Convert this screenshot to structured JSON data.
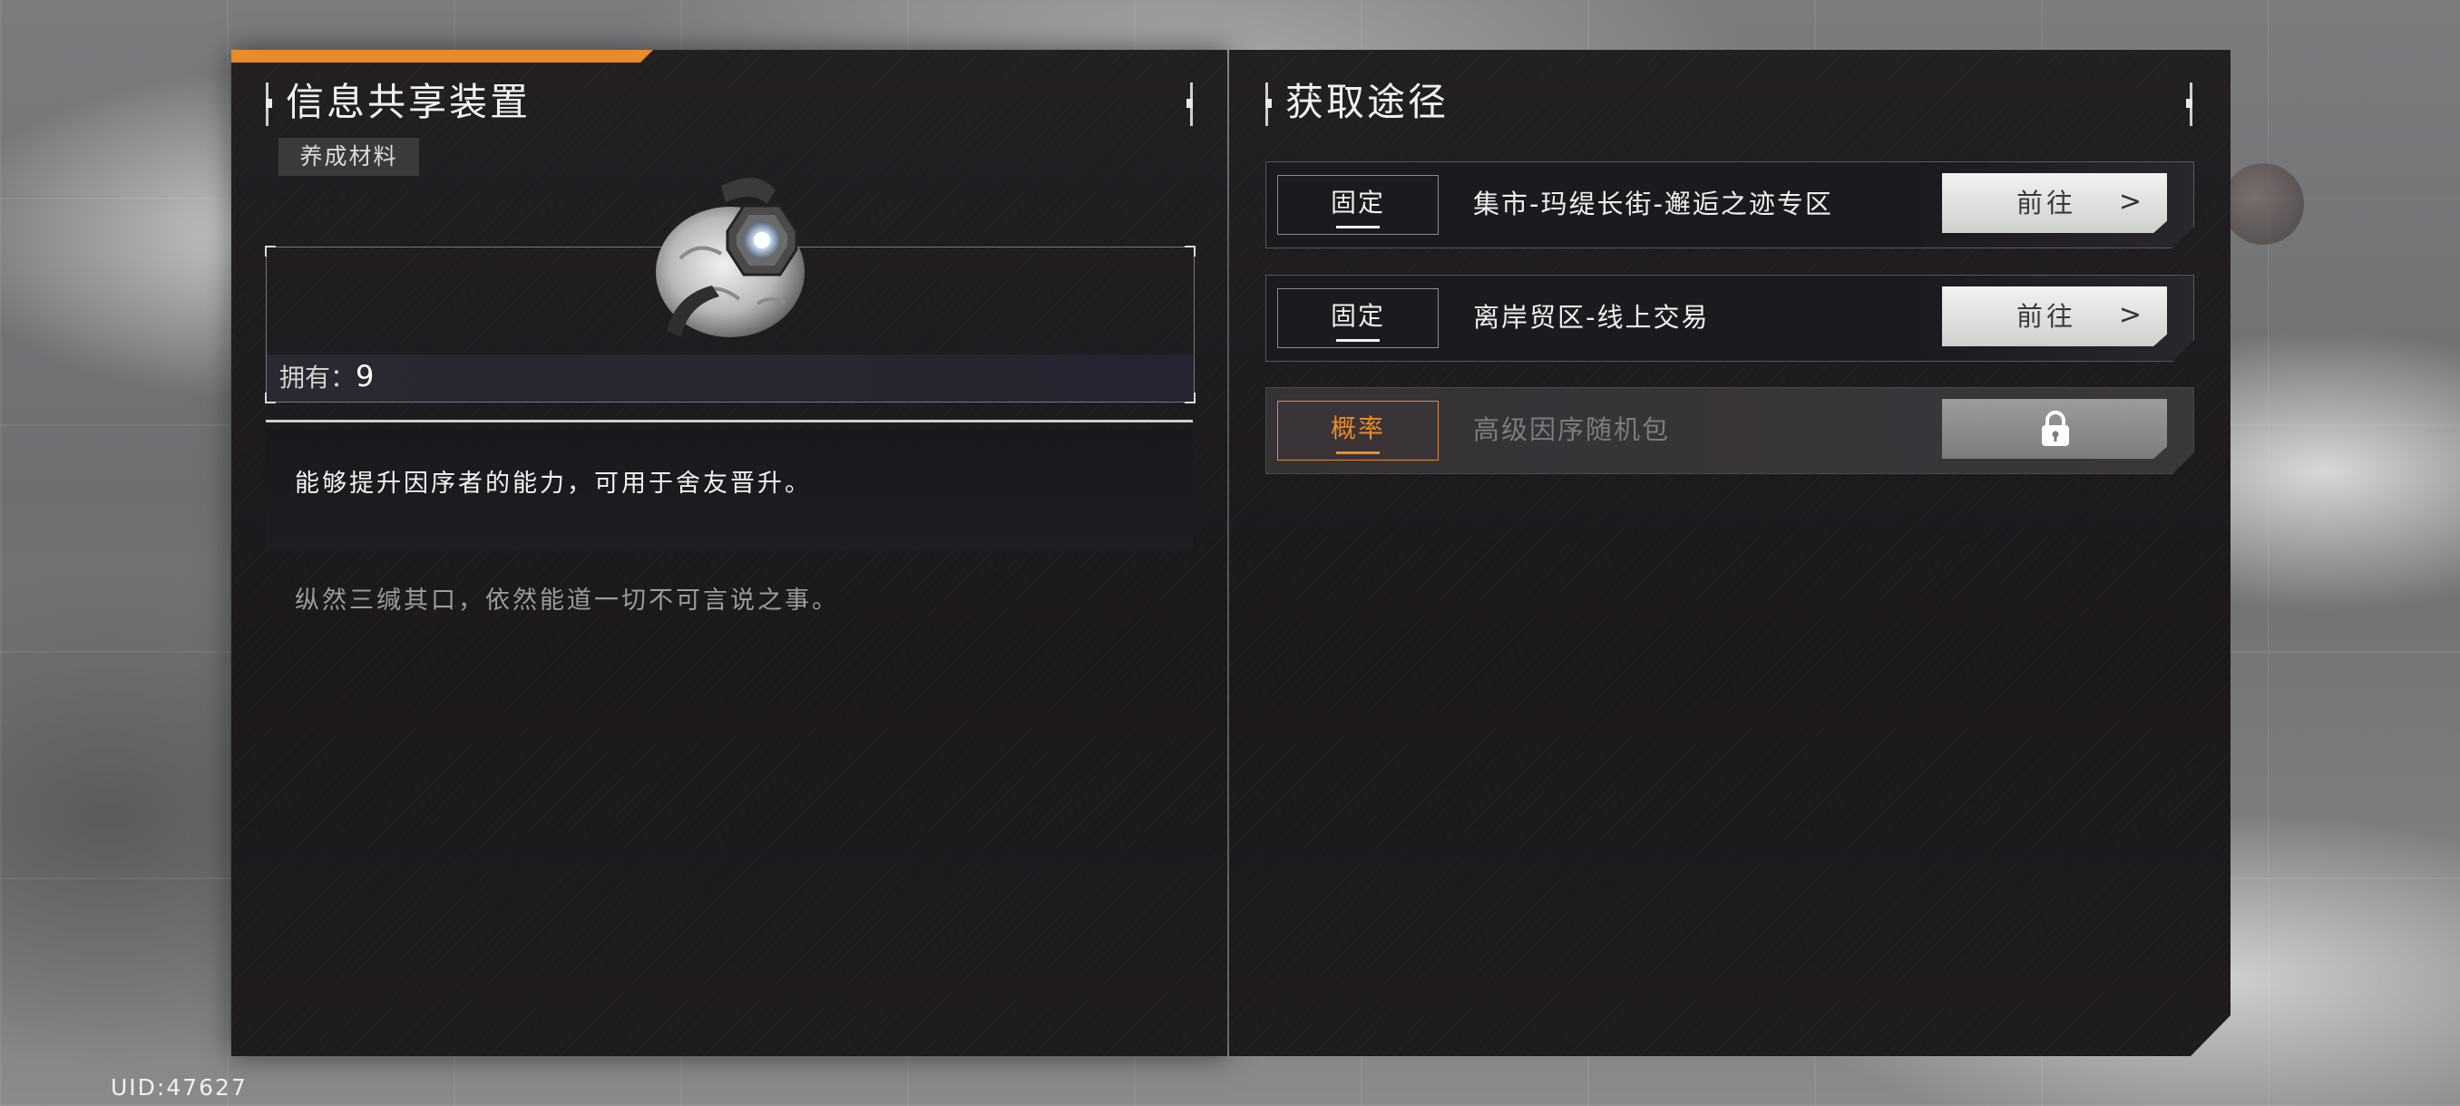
{
  "item": {
    "name": "信息共享装置",
    "category_tag": "养成材料",
    "owned_label": "拥有：",
    "owned_count": "9",
    "description": "能够提升因序者的能力，可用于舍友晋升。",
    "flavor": "纵然三缄其口，依然能道一切不可言说之事。"
  },
  "acquisition": {
    "title": "获取途径",
    "sources": [
      {
        "type": "固定",
        "name": "集市-玛缇长街-邂逅之迹专区",
        "button": "前往",
        "arrow": ">"
      },
      {
        "type": "固定",
        "name": "离岸贸区-线上交易",
        "button": "前往",
        "arrow": ">"
      },
      {
        "type": "概率",
        "name": "高级因序随机包",
        "locked": true
      }
    ]
  },
  "footer": {
    "uid": "UID:47627"
  },
  "colors": {
    "accent": "#e98b2a",
    "panel_bg": "#1d1a1f",
    "button_bg": "#e6e6e6"
  }
}
